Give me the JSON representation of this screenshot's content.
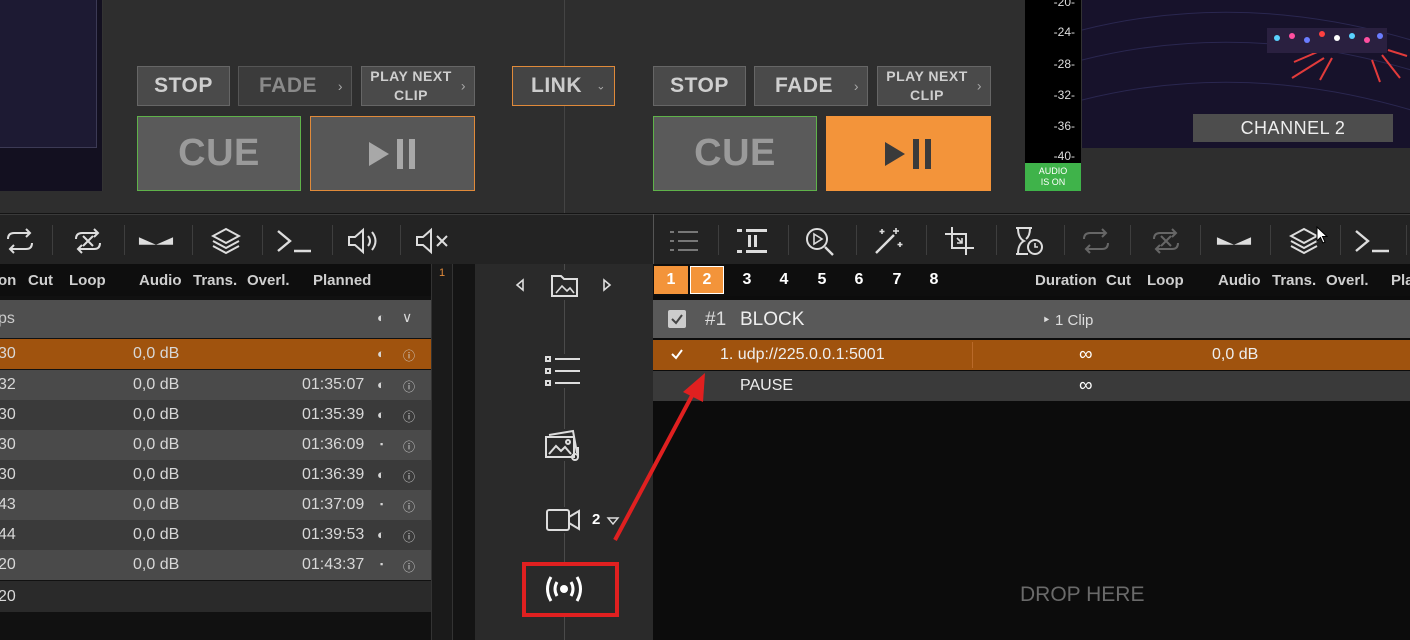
{
  "left_channel": {
    "stop_label": "STOP",
    "fade_label": "FADE",
    "play_next_line1": "PLAY NEXT",
    "play_next_line2": "CLIP",
    "cue_label": "CUE"
  },
  "link_label": "LINK",
  "right_channel": {
    "stop_label": "STOP",
    "fade_label": "FADE",
    "play_next_line1": "PLAY NEXT",
    "play_next_line2": "CLIP",
    "cue_label": "CUE"
  },
  "meter": {
    "labels": [
      "-20-",
      "-24-",
      "-28-",
      "-32-",
      "-36-",
      "-40-"
    ],
    "audio_badge_line1": "AUDIO",
    "audio_badge_line2": "IS ON"
  },
  "channel_label": "CHANNEL 2",
  "left_table": {
    "headers": {
      "on": "on",
      "cut": "Cut",
      "loop": "Loop",
      "audio": "Audio",
      "trans": "Trans.",
      "overl": "Overl.",
      "planned": "Planned"
    },
    "group_label": "ps",
    "rows": [
      {
        "dur": "30",
        "audio": "0,0 dB",
        "planned": "",
        "mark": "◐"
      },
      {
        "dur": "32",
        "audio": "0,0 dB",
        "planned": "01:35:07",
        "mark": "◐"
      },
      {
        "dur": "30",
        "audio": "0,0 dB",
        "planned": "01:35:39",
        "mark": "◐"
      },
      {
        "dur": "30",
        "audio": "0,0 dB",
        "planned": "01:36:09",
        "mark": "▪"
      },
      {
        "dur": "30",
        "audio": "0,0 dB",
        "planned": "01:36:39",
        "mark": "◐"
      },
      {
        "dur": "43",
        "audio": "0,0 dB",
        "planned": "01:37:09",
        "mark": "▪"
      },
      {
        "dur": "44",
        "audio": "0,0 dB",
        "planned": "01:39:53",
        "mark": "◐"
      },
      {
        "dur": "20",
        "audio": "0,0 dB",
        "planned": "01:43:37",
        "mark": "▪"
      }
    ],
    "last_row": "20",
    "gutter_number": "1"
  },
  "center": {
    "camera_count": "2"
  },
  "right_table": {
    "tabs": [
      "1",
      "2",
      "3",
      "4",
      "5",
      "6",
      "7",
      "8"
    ],
    "headers": {
      "duration": "Duration",
      "cut": "Cut",
      "loop": "Loop",
      "audio": "Audio",
      "trans": "Trans.",
      "overl": "Overl.",
      "planned": "Pla"
    },
    "block_number": "#1",
    "block_name": "BLOCK",
    "block_clips": "‣ 1 Clip",
    "item_label": "1. udp://225.0.0.1:5001",
    "item_duration": "∞",
    "item_audio": "0,0 dB",
    "pause_label": "PAUSE",
    "pause_duration": "∞",
    "drop_label": "DROP HERE"
  },
  "colors": {
    "accent_orange": "#f3943a",
    "row_selected": "#a0530e",
    "cue_border": "#5fb24a",
    "audio_green": "#3fb34a",
    "annotation_red": "#e02020"
  }
}
